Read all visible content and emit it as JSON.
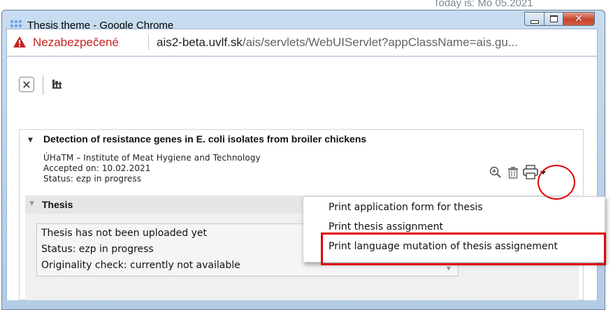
{
  "background": {
    "date_text": "Today is: Mo 05.2021"
  },
  "window": {
    "title": "Thesis theme - Google Chrome",
    "controls": {
      "minimize": "minimize",
      "maximize": "maximize",
      "close": "close"
    }
  },
  "address_bar": {
    "security_label": "Nezabezpečené",
    "url_host": "ais2-beta.uvlf.sk",
    "url_path": "/ais/servlets/WebUIServlet?appClassName=ais.gu..."
  },
  "toolbar": {
    "close_glyph": "✕"
  },
  "panel": {
    "title": "Detection of resistance genes in E. coli isolates from broiler chickens",
    "department": "ÚHaTM – Institute of Meat Hygiene and Technology",
    "accepted": "Accepted on: 10.02.2021",
    "status": "Status: ezp in progress"
  },
  "thesis": {
    "title": "Thesis",
    "lines": [
      "Thesis has not been uploaded yet",
      "Status: ezp in progress",
      "Originality check: currently not available"
    ]
  },
  "print_menu": {
    "items": [
      "Print application form for thesis",
      "Print thesis assignment",
      "Print language mutation of thesis assignement"
    ]
  },
  "colors": {
    "insecure_red": "#c5221f",
    "highlight_red": "#e00000",
    "frame_blue": "#b4cbe5"
  }
}
